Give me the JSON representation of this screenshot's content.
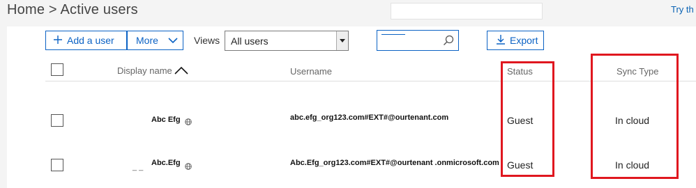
{
  "breadcrumb": {
    "home": "Home",
    "separator": " > ",
    "current": "Active users"
  },
  "top": {
    "try_link": "Try th"
  },
  "toolbar": {
    "add_user_label": "Add a user",
    "more_label": "More",
    "views_label": "Views",
    "views_selected": "All users",
    "export_label": "Export"
  },
  "table": {
    "headers": {
      "display_name": "Display name",
      "username": "Username",
      "status": "Status",
      "sync_type": "Sync Type"
    },
    "sort_indicator": "^",
    "rows": [
      {
        "display_name": "Abc Efg",
        "username": "abc.efg_org123.com#EXT#@ourtenant.com",
        "status": "Guest",
        "sync_type": "In cloud"
      },
      {
        "display_name": "Abc.Efg",
        "username": "Abc.Efg_org123.com#EXT#@ourtenant .onmicrosoft.com",
        "status": "Guest",
        "sync_type": "In cloud"
      }
    ]
  },
  "colors": {
    "accent": "#0b62c4",
    "highlight": "#e0171f",
    "link": "#0a63b4"
  },
  "icons": [
    "plus-icon",
    "chevron-down-icon",
    "search-icon",
    "download-icon",
    "globe-icon",
    "sort-up-icon"
  ]
}
